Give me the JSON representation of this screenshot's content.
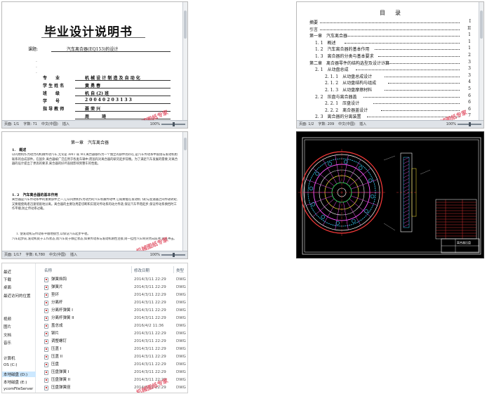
{
  "cover": {
    "title": "毕业设计说明书",
    "topic_label": "课题:",
    "topic_value": "汽车离合器(EQ153)的设计",
    "fields": [
      {
        "label": "专　　业",
        "value": "机 械 设 计 制 造 及 自 动 化"
      },
      {
        "label": "学 生 姓 名",
        "value": "黄 勇 春"
      },
      {
        "label": "班　　级",
        "value": "机 自 (2) 班"
      },
      {
        "label": "学　　号",
        "value": "2 0 0 4 0 2 0 3 1 3 3"
      },
      {
        "label": "指 导 教 师",
        "value": "聂 荣 兴"
      },
      {
        "label": "",
        "value": "周　　　琦"
      }
    ],
    "status_page": "页面: 1/1",
    "status_words": "字数: 71",
    "status_lang": "中文(中国)",
    "status_mode": "插入",
    "status_zoom": "100%",
    "watermark": "机械图纸专家"
  },
  "toc": {
    "title": "目　录",
    "rows": [
      {
        "text": "摘要",
        "page": "I"
      },
      {
        "text": "引言",
        "page": "II"
      },
      {
        "text": "第一章　汽车离合器",
        "page": "1"
      },
      {
        "text": "1. 1　概述",
        "page": "1"
      },
      {
        "text": "1. 2　汽车离合器的基本作用",
        "page": "1"
      },
      {
        "text": "1. 3　离合器的分类与基本要求",
        "page": "2"
      },
      {
        "text": "第二章　离合器零件的结构选型及设计计算",
        "page": "3"
      },
      {
        "text": "2. 1　从动盘总成",
        "page": "3"
      },
      {
        "text": "2. 1. 1　从动盘总成设计",
        "page": "3"
      },
      {
        "text": "2. 1. 2　从动盘结构与组成",
        "page": "4"
      },
      {
        "text": "2. 1. 3　从动盘摩擦材料",
        "page": "5"
      },
      {
        "text": "2. 2　压盘与离合器盖",
        "page": "6"
      },
      {
        "text": "2. 2. 1　压盘设计",
        "page": "6"
      },
      {
        "text": "2. 2. 2　离合器盖设计",
        "page": "6"
      },
      {
        "text": "2. 3　离合器的分离装置",
        "page": "7"
      }
    ],
    "status_page": "页面: 1/2",
    "status_words": "字数: 209",
    "status_lang": "中文(中国)",
    "status_mode": "插入",
    "status_zoom": "100%",
    "watermark": "机械图纸专家"
  },
  "chapter": {
    "title": "第一章　汽车离合器",
    "h1": "1.　概述",
    "p1": "以内燃机作为动力的机械传动汽车,无论是 AMT 或 MT,离合器都作为一个独立的部件而存在,是汽车传动系中直接与发动机相联系的总成部件。在国外,离合器被广泛应用于各类车辆中,而国内对离合器的研究起步较晚。为了满足汽车发展的需要,对离合器的设计提出了更高的要求,离合器的好坏直接影响到整车的性能。",
    "h2": "1. 2　汽车离合器的基本作用",
    "p2": "离合器是汽车传动系中的重要部件之一,它以内燃机作为动力的汽车机械传动中,它既要能在发动机飞轮与变速器之间传递转矩,又要能使两者迅速彻底地分离。离合器的主要功用是切断和实现对传动系的动力传递,保证汽车平稳起步,保证传动系换挡时工作平顺,防止传动系过载。",
    "p3": "1. 使发动机与传动系平顺地接合,以保证汽车起步平稳。",
    "p4": "汽车起步前,发动机处于工作状态,而汽车处于静止状态,如果传动系与发动机刚性连接,则一挂挡汽车将突然向前冲,造成冲击。",
    "status_page": "页面: 1/17",
    "status_words": "字数: 6,780",
    "status_lang": "中文(中国)",
    "status_mode": "插入",
    "status_zoom": "100%",
    "watermark": "机械图纸专家"
  },
  "cad": {
    "title_block_label": "离合器压盘"
  },
  "explorer": {
    "nav": [
      "最近",
      "下载",
      "桌面",
      "最近访问的位置",
      "",
      "",
      "视频",
      "图片",
      "文档",
      "音乐",
      "",
      "计算机",
      "OS (C:)",
      "本地磁盘 (D:)",
      "本地磁盘 (E:)",
      "ycomFileServer"
    ],
    "nav_selected": 13,
    "columns": {
      "name": "名称",
      "date": "修改日期",
      "type": "类型"
    },
    "files": [
      {
        "name": "弹簧挡钩",
        "date": "2014/3/11 22:29",
        "type": "DWG 文"
      },
      {
        "name": "弹簧片",
        "date": "2014/3/11 22:29",
        "type": "DWG 文"
      },
      {
        "name": "垫环",
        "date": "2014/3/11 22:29",
        "type": "DWG 文"
      },
      {
        "name": "分离杆",
        "date": "2014/3/11 22:29",
        "type": "DWG 文"
      },
      {
        "name": "分离杆弹簧 I",
        "date": "2014/3/11 22:29",
        "type": "DWG 文"
      },
      {
        "name": "分离杆弹簧 II",
        "date": "2014/3/11 22:29",
        "type": "DWG 文"
      },
      {
        "name": "盖总成",
        "date": "2016/4/2 11:36",
        "type": "DWG 文"
      },
      {
        "name": "铆片",
        "date": "2014/3/11 22:29",
        "type": "DWG 文"
      },
      {
        "name": "调整螺钉",
        "date": "2014/3/11 22:29",
        "type": "DWG 文"
      },
      {
        "name": "压盖 I",
        "date": "2014/3/11 22:29",
        "type": "DWG 文"
      },
      {
        "name": "压盖 II",
        "date": "2014/3/11 22:29",
        "type": "DWG 文"
      },
      {
        "name": "压盘",
        "date": "2014/3/11 22:29",
        "type": "DWG 文"
      },
      {
        "name": "压盘弹簧 I",
        "date": "2014/3/11 22:29",
        "type": "DWG 文"
      },
      {
        "name": "压盘弹簧 II",
        "date": "2014/3/11 22:29",
        "type": "DWG 文"
      },
      {
        "name": "压盘弹簧座",
        "date": "2014/3/11 22:29",
        "type": "DWG 文"
      }
    ],
    "watermark": "机械图纸专家"
  }
}
